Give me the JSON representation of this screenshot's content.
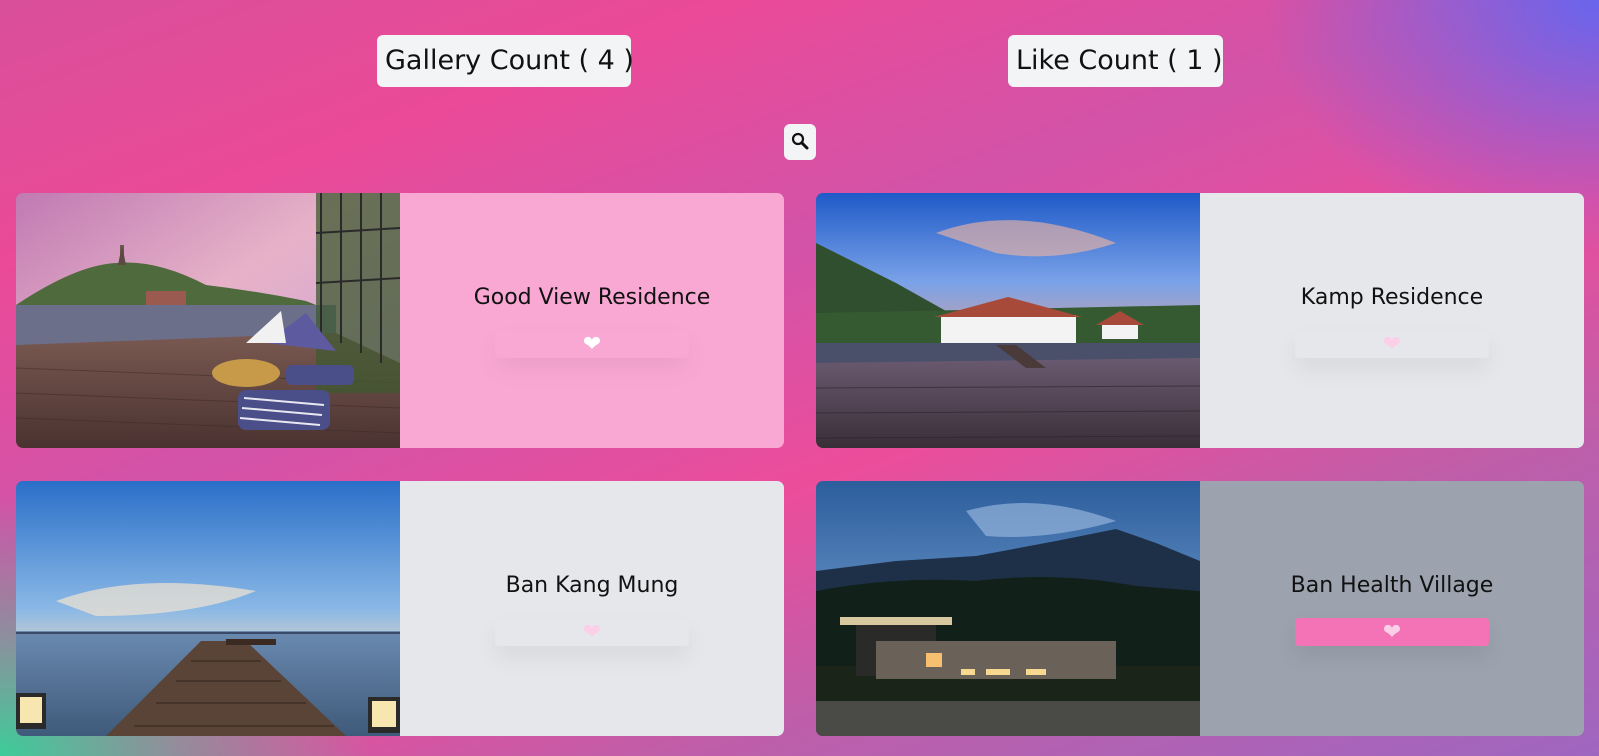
{
  "header": {
    "gallery_count_label": "Gallery Count ( 4 )",
    "like_count_label": "Like Count ( 1 )"
  },
  "search": {
    "icon": "search-icon"
  },
  "colors": {
    "badge_bg": "#f3f4f6",
    "liked_button": "#f472b6",
    "heart_light": "#fbcfe8",
    "heart_white": "#ffffff"
  },
  "gallery": [
    {
      "title": "Good View Residence",
      "panel_color": "#f9a8d4",
      "heart_color": "#ffffff",
      "liked": false,
      "photo": "rooftop deck with cushions overlooking a hill with a pagoda at sunset"
    },
    {
      "title": "Kamp Residence",
      "panel_color": "#e5e7eb",
      "heart_color": "#fbcfe8",
      "liked": false,
      "photo": "wooden pier leading to a lakeside resort under a colorful sunset sky"
    },
    {
      "title": "Ban Kang Mung",
      "panel_color": "#e5e7eb",
      "heart_color": "#fbcfe8",
      "liked": false,
      "photo": "long wooden jetty stretching into calm sea at dusk"
    },
    {
      "title": "Ban Health Village",
      "panel_color": "#9ca3af",
      "heart_color": "#fbcfe8",
      "liked": true,
      "photo": "modern house lit at night beneath forested mountains"
    }
  ]
}
